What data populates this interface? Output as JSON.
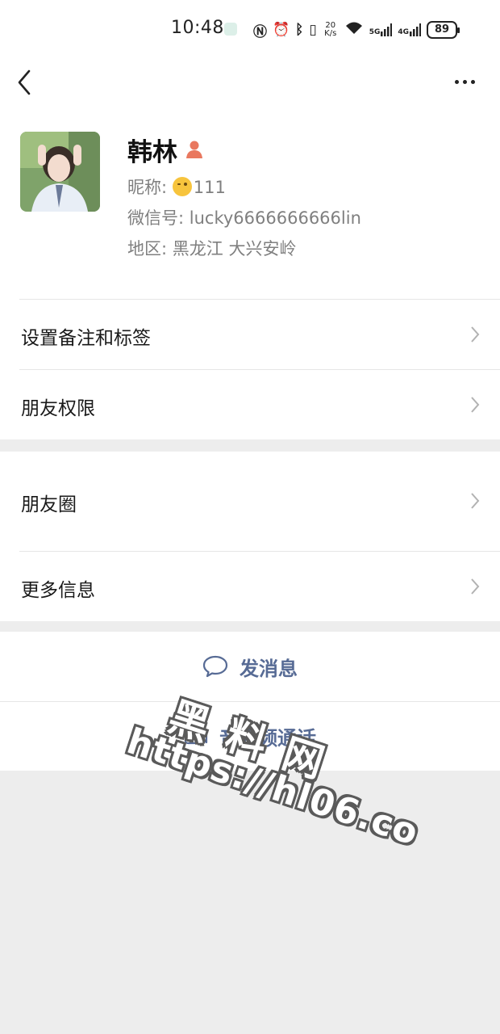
{
  "status_bar": {
    "time": "10:48",
    "net_speed_value": "20",
    "net_speed_unit": "K/s",
    "signal_5g": "5G",
    "signal_4g": "4G",
    "battery": "89"
  },
  "profile": {
    "name": "韩林",
    "nickname_label": "昵称: ",
    "nickname_value": "111",
    "wechat_id_label": "微信号: ",
    "wechat_id_value": "lucky6666666666lin",
    "region_label": "地区: ",
    "region_value": "黑龙江  大兴安岭"
  },
  "menu": {
    "remarks_tags": "设置备注和标签",
    "friend_permissions": "朋友权限",
    "moments": "朋友圈",
    "more_info": "更多信息"
  },
  "actions": {
    "send_message": "发消息",
    "av_call": "音视频通话"
  },
  "watermark": {
    "chinese": "黑料网",
    "url": "https://hl06.co"
  },
  "colors": {
    "link_blue": "#576b95",
    "background": "#ededed",
    "female_icon": "#e9785f"
  }
}
